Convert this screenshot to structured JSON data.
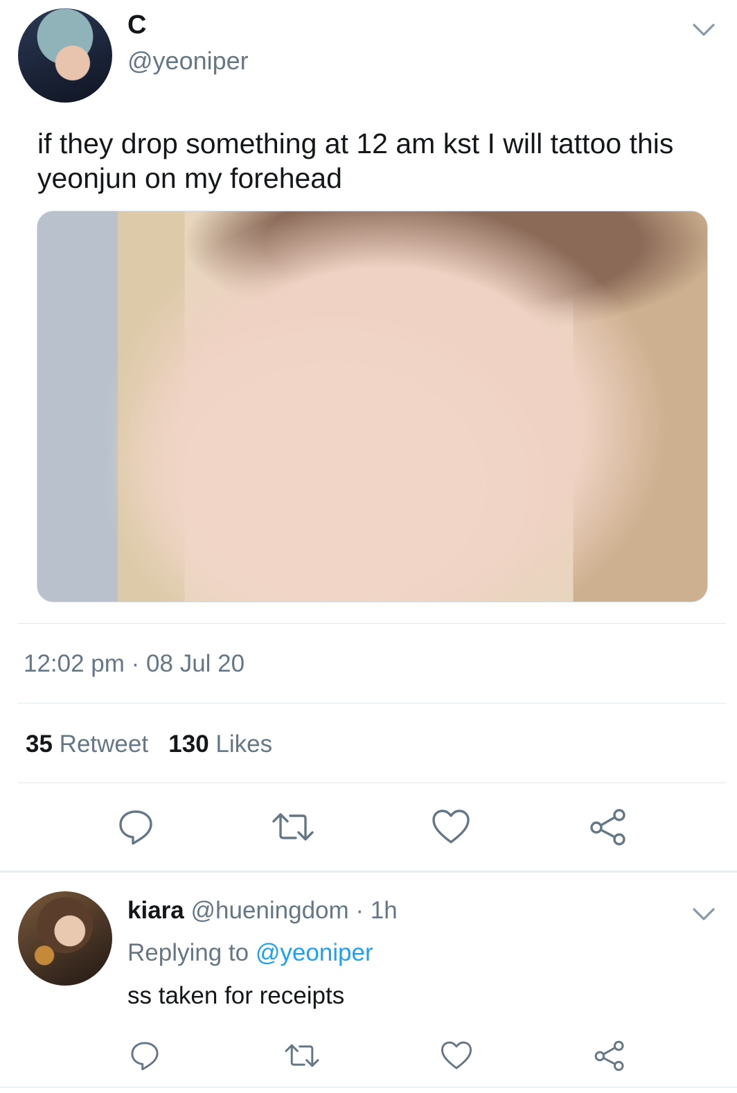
{
  "tweet": {
    "author_name": "C",
    "author_handle": "@yeoniper",
    "text": "if they drop something at 12 am kst I will tattoo this yeonjun on my forehead",
    "time": "12:02 pm",
    "date_sep": " · ",
    "date": "08 Jul 20",
    "retweet_count": "35",
    "retweet_label": "Retweet",
    "like_count": "130",
    "like_label": "Likes"
  },
  "reply": {
    "author_name": "kiara",
    "author_handle": "@hueningdom",
    "time_sep": " · ",
    "time": "1h",
    "replying_label": "Replying to",
    "replying_to": "@yeoniper",
    "text": "ss taken for receipts"
  },
  "icons": {
    "more": "chevron-down-icon",
    "reply": "speech-bubble-icon",
    "retweet": "retweet-icon",
    "like": "heart-icon",
    "share": "share-icon"
  },
  "colors": {
    "text_primary": "#14171a",
    "text_secondary": "#657786",
    "link": "#1da1f2",
    "divider": "#e1e8ed"
  }
}
